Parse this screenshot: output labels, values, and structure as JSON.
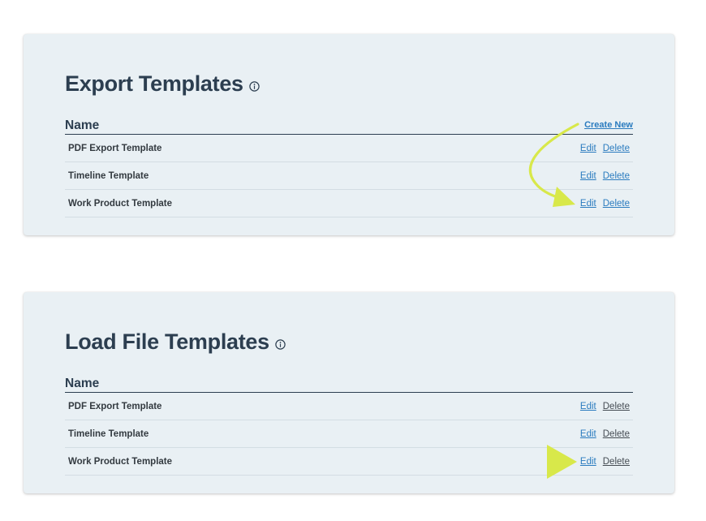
{
  "export_panel": {
    "title": "Export Templates",
    "column_header": "Name",
    "create_new_label": "Create New",
    "rows": [
      {
        "name": "PDF Export Template",
        "edit_label": "Edit",
        "delete_label": "Delete"
      },
      {
        "name": "Timeline Template",
        "edit_label": "Edit",
        "delete_label": "Delete"
      },
      {
        "name": "Work Product Template",
        "edit_label": "Edit",
        "delete_label": "Delete"
      }
    ]
  },
  "load_panel": {
    "title": "Load File Templates",
    "column_header": "Name",
    "rows": [
      {
        "name": "PDF Export Template",
        "edit_label": "Edit",
        "delete_label": "Delete"
      },
      {
        "name": "Timeline Template",
        "edit_label": "Edit",
        "delete_label": "Delete"
      },
      {
        "name": "Work Product Template",
        "edit_label": "Edit",
        "delete_label": "Delete"
      }
    ]
  },
  "colors": {
    "panel_background": "#e9f0f4",
    "heading": "#2c3e50",
    "link": "#2a7bbf",
    "annotation_arrow": "#d8e84a"
  }
}
